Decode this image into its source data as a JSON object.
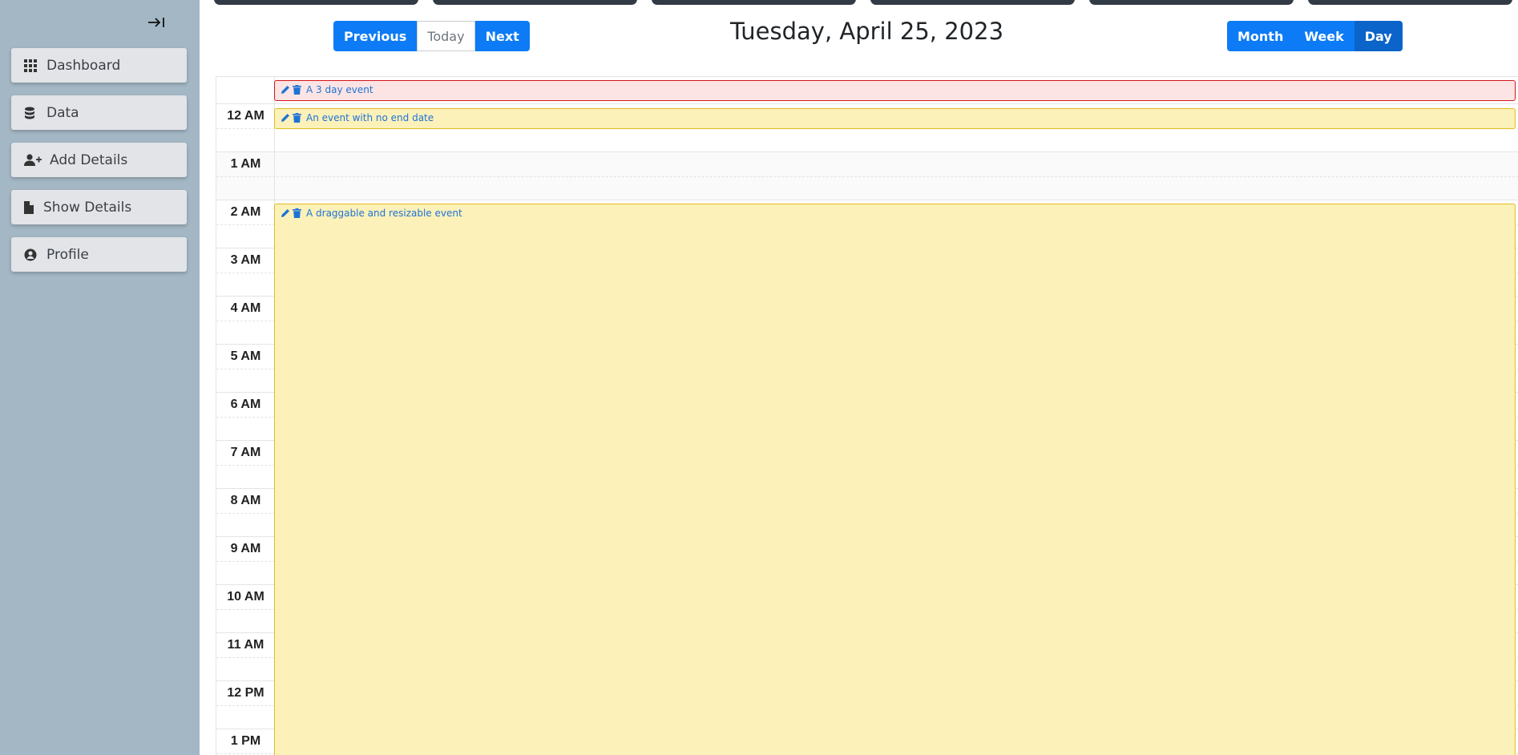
{
  "sidebar": {
    "collapse_icon": "collapse-right-icon",
    "items": [
      {
        "label": "Dashboard",
        "icon": "grid-icon"
      },
      {
        "label": "Data",
        "icon": "database-icon"
      },
      {
        "label": "Add Details",
        "icon": "user-plus-icon"
      },
      {
        "label": "Show Details",
        "icon": "file-icon"
      },
      {
        "label": "Profile",
        "icon": "user-circle-icon"
      }
    ]
  },
  "toolbar": {
    "previous_label": "Previous",
    "today_label": "Today",
    "next_label": "Next",
    "title": "Tuesday, April 25, 2023",
    "views": {
      "month": "Month",
      "week": "Week",
      "day": "Day"
    },
    "active_view": "Day"
  },
  "calendar": {
    "hours": [
      "12 AM",
      "1 AM",
      "2 AM",
      "3 AM",
      "4 AM",
      "5 AM",
      "6 AM",
      "7 AM",
      "8 AM",
      "9 AM",
      "10 AM",
      "11 AM",
      "12 PM",
      "1 PM"
    ],
    "events": {
      "allday": {
        "title": "A 3 day event",
        "color": "#d3151b",
        "bg": "#fce4e4"
      },
      "no_end": {
        "title": "An event with no end date",
        "color": "#e2bd21",
        "bg": "#fcf1b9"
      },
      "draggable": {
        "title": "A draggable and resizable event",
        "color": "#e2bd21",
        "bg": "#fcf1b9"
      }
    },
    "event_icons": [
      "pencil-icon",
      "trash-icon"
    ]
  },
  "colors": {
    "sidebar_bg": "#a3b7c4",
    "primary": "#0d7bf5",
    "primary_active": "#0a64c9",
    "event_text": "#1e73d6"
  }
}
